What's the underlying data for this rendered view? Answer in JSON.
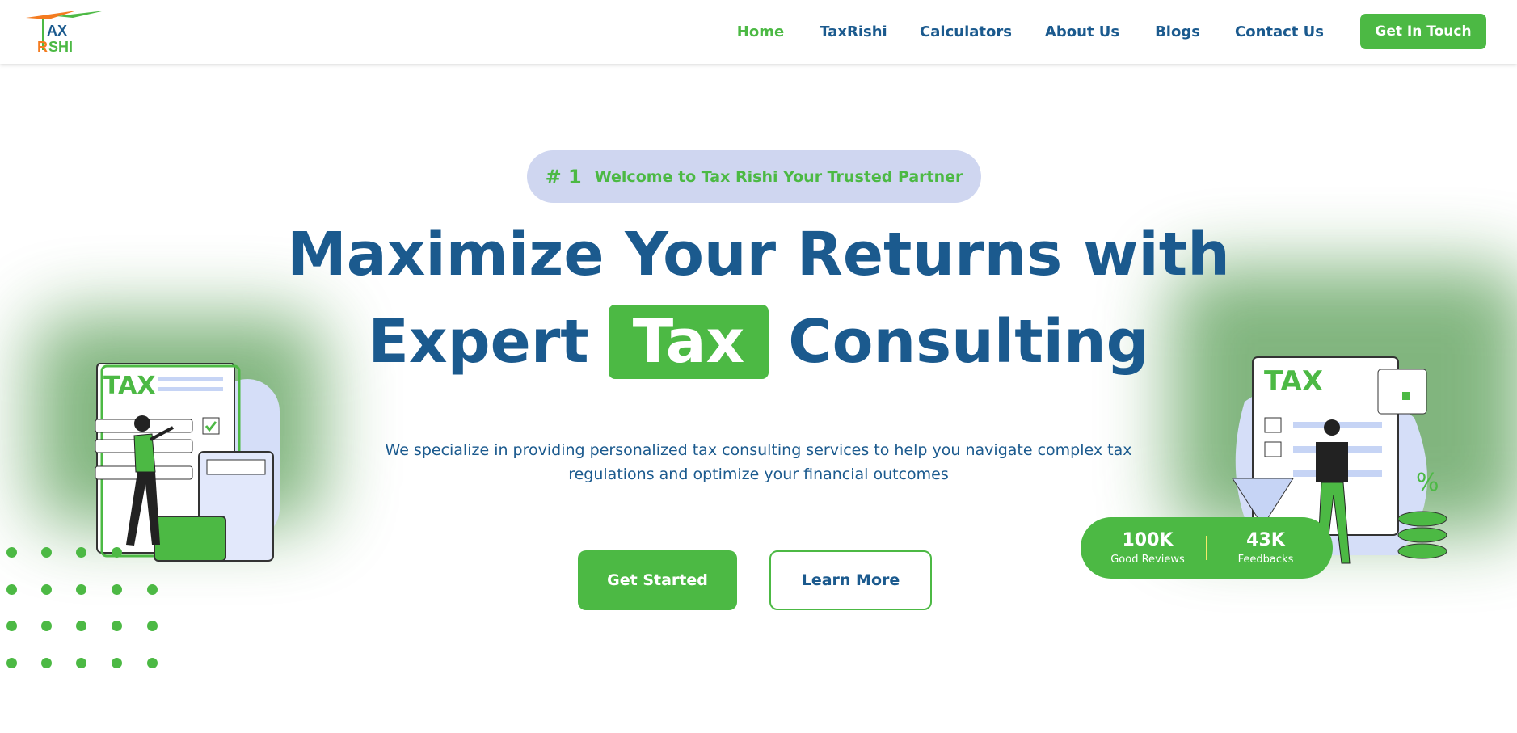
{
  "brand": {
    "logo_text_top": "AX",
    "logo_text_bottom": "RISHI",
    "colors": {
      "primary": "#1b5a8e",
      "accent": "#4cb944",
      "logo_orange": "#f47b20"
    }
  },
  "nav": {
    "items": [
      {
        "label": "Home",
        "active": true
      },
      {
        "label": "TaxRishi"
      },
      {
        "label": "Calculators"
      },
      {
        "label": "About Us"
      },
      {
        "label": "Blogs"
      },
      {
        "label": "Contact Us"
      }
    ],
    "cta": "Get In Touch"
  },
  "hero": {
    "badge_number": "# 1",
    "badge_text": "Welcome to Tax Rishi Your Trusted Partner",
    "title_line1": "Maximize Your Returns with",
    "title_pre": "Expert",
    "title_highlight": "Tax",
    "title_post": "Consulting",
    "description": "We specialize in providing personalized tax consulting services to help you navigate complex tax regulations and optimize your financial outcomes",
    "primary_button": "Get Started",
    "secondary_button": "Learn More"
  },
  "illustrations": {
    "left_label": "TAX",
    "right_label": "TAX",
    "right_percent": "%"
  },
  "stats": [
    {
      "value": "100K",
      "label": "Good Reviews"
    },
    {
      "value": "43K",
      "label": "Feedbacks"
    }
  ]
}
